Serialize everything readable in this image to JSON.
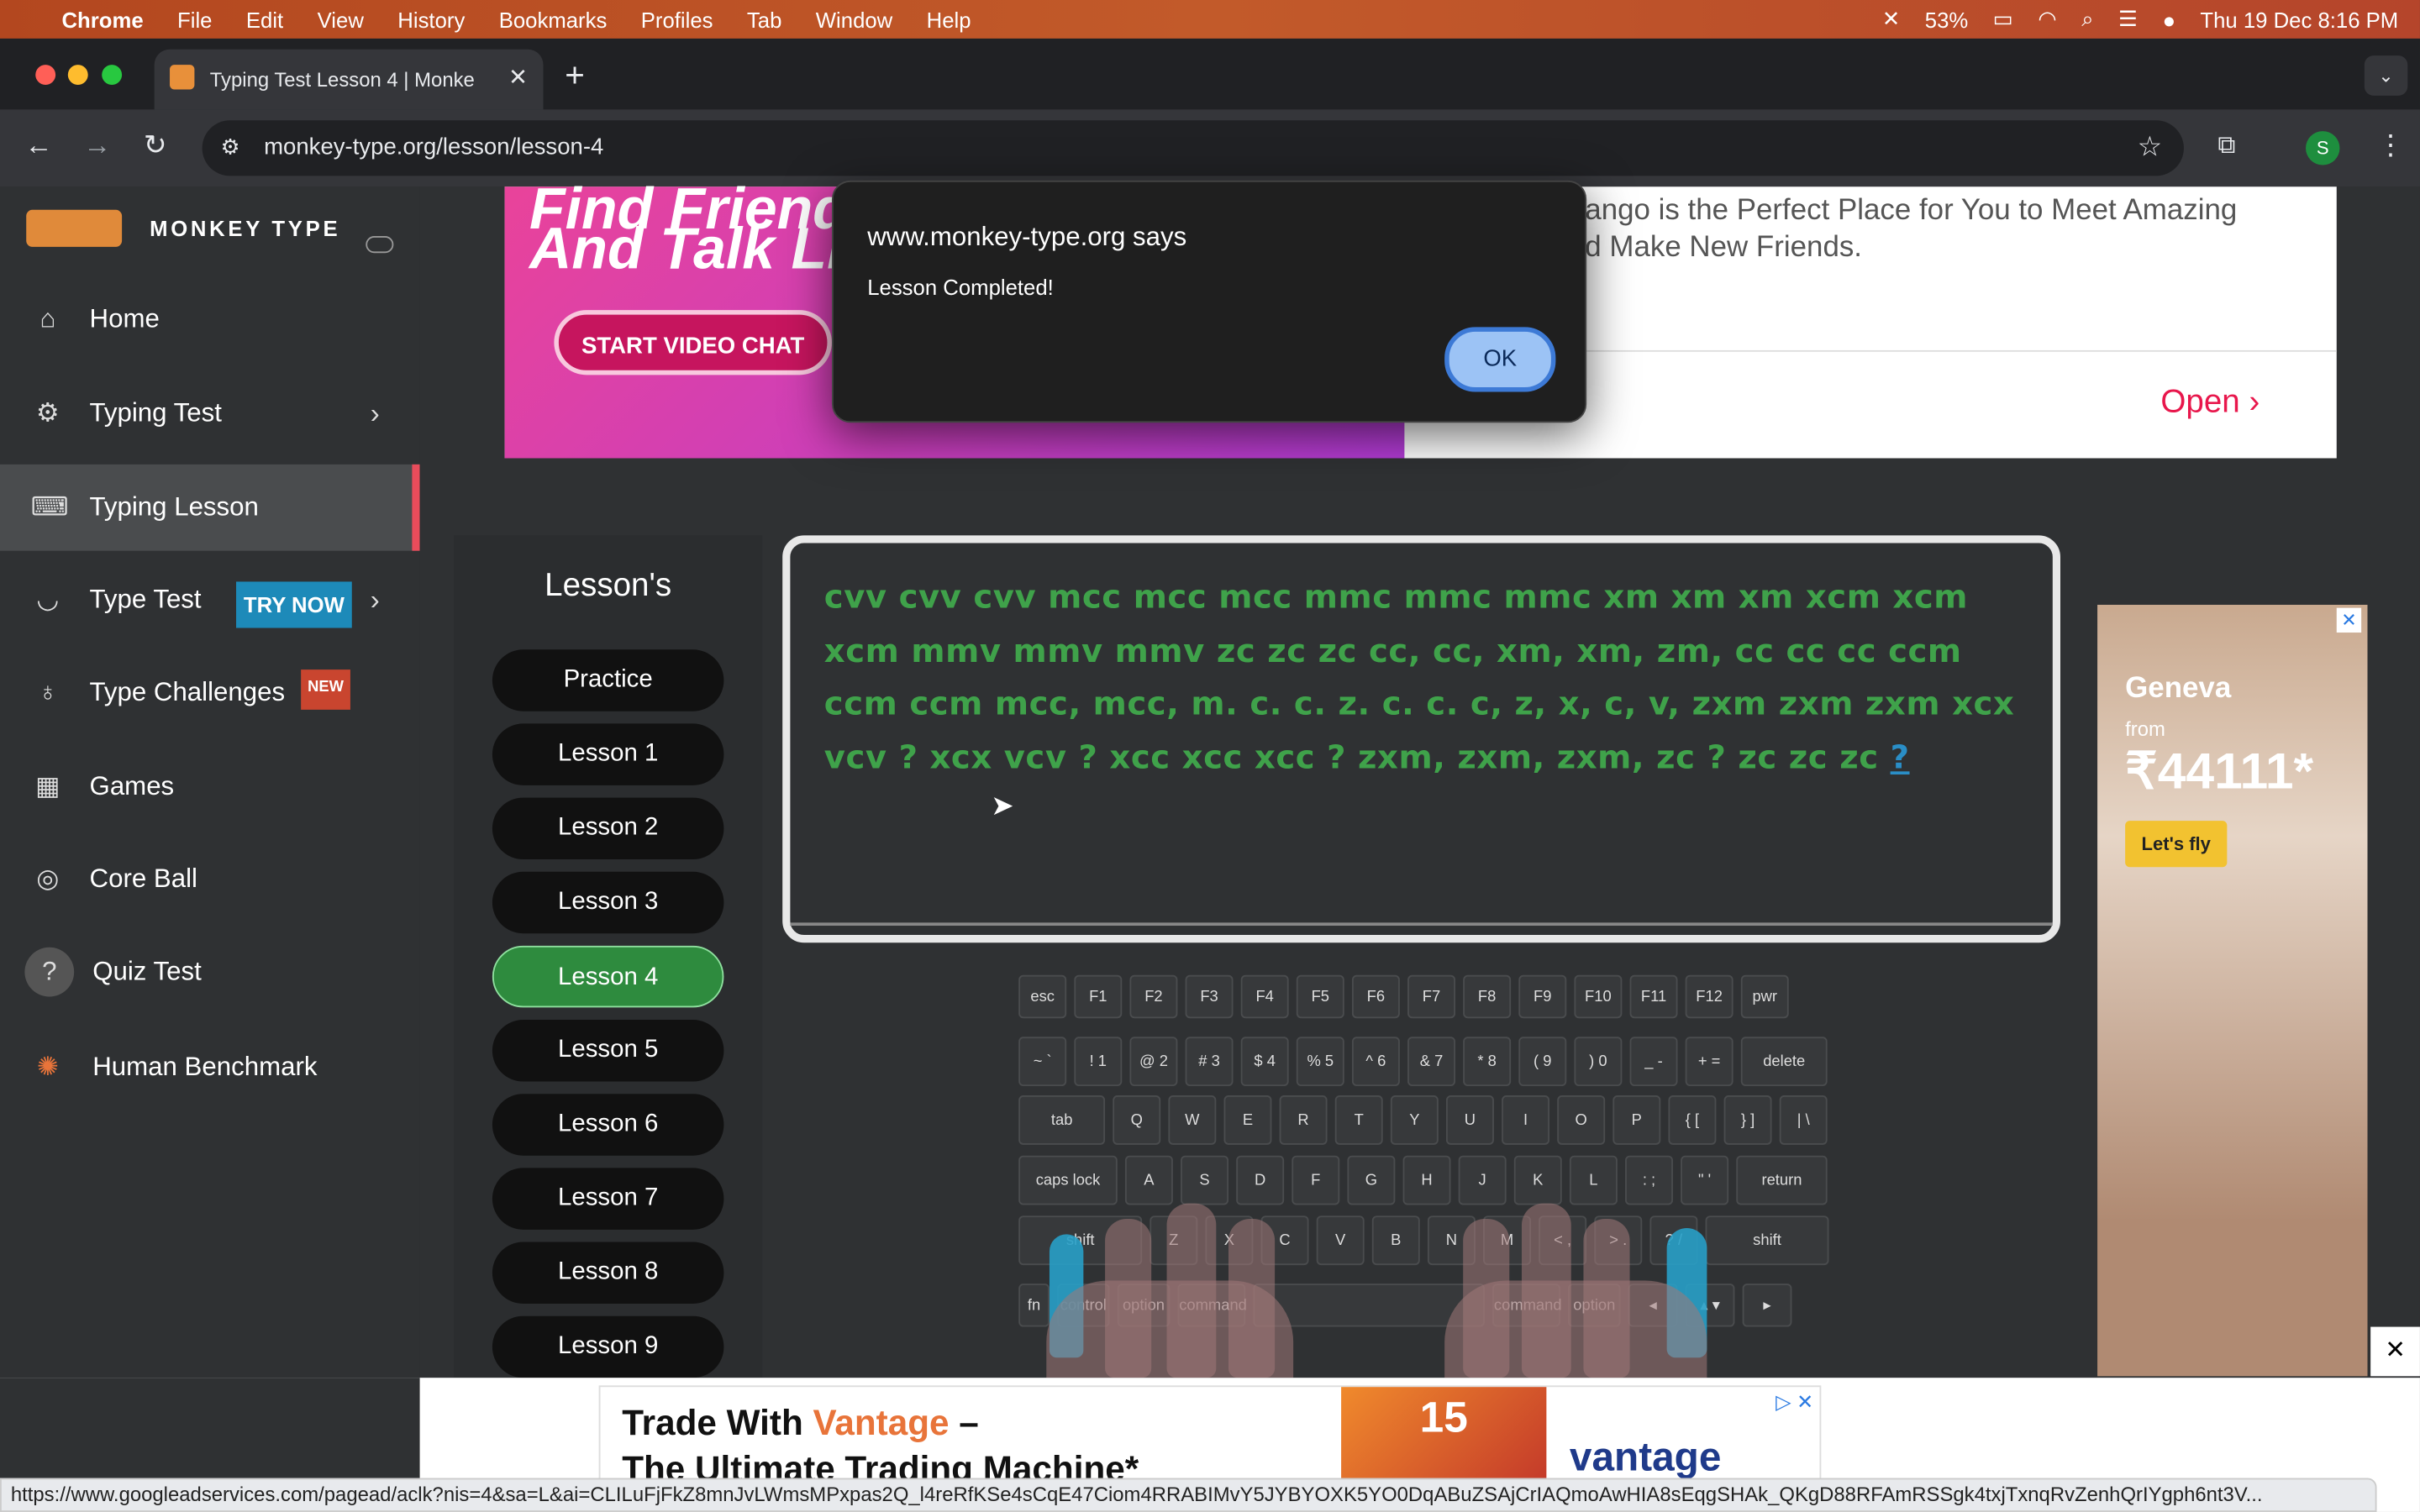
{
  "menubar": {
    "app": "Chrome",
    "items": [
      "File",
      "Edit",
      "View",
      "History",
      "Bookmarks",
      "Profiles",
      "Tab",
      "Window",
      "Help"
    ],
    "battery": "53%",
    "datetime": "Thu 19 Dec  8:16 PM"
  },
  "browser": {
    "tab_title": "Typing Test Lesson 4 | Monke",
    "url": "monkey-type.org/lesson/lesson-4",
    "profile_initial": "S"
  },
  "sidebar": {
    "brand": "MONKEY TYPE",
    "items": [
      {
        "label": "Home",
        "icon": "home-icon"
      },
      {
        "label": "Typing Test",
        "icon": "gear-icon"
      },
      {
        "label": "Typing Lesson",
        "icon": "keyboard-icon"
      },
      {
        "label": "Type Test",
        "icon": "cat-icon"
      },
      {
        "label": "Type Challenges",
        "icon": "award-icon"
      },
      {
        "label": "Games",
        "icon": "grid-icon"
      },
      {
        "label": "Core Ball",
        "icon": "target-icon"
      },
      {
        "label": "Quiz Test",
        "icon": "quiz-icon"
      },
      {
        "label": "Human Benchmark",
        "icon": "brain-icon"
      }
    ],
    "try_now": "TRY NOW",
    "new_badge": "NEW"
  },
  "ad_top": {
    "headline_1": "Find Friends",
    "headline_2": "And Talk Live",
    "cta": "START VIDEO CHAT",
    "text_1": "ango is the Perfect Place for You to Meet Amazing",
    "text_2": "d Make New Friends.",
    "open": "Open"
  },
  "lessons": {
    "title": "Lesson's",
    "items": [
      "Practice",
      "Lesson 1",
      "Lesson 2",
      "Lesson 3",
      "Lesson 4",
      "Lesson 5",
      "Lesson 6",
      "Lesson 7",
      "Lesson 8",
      "Lesson 9"
    ],
    "active": "Lesson 4"
  },
  "typing": {
    "text": "cvv cvv cvv mcc mcc mcc mmc mmc mmc xm xm xm xcm xcm xcm mmv mmv mmv zc zc zc cc, cc, xm, xm, zm, cc cc cc ccm ccm ccm mcc, mcc, m. c. c. z. c. c. c, z, x, c, v, zxm zxm zxm xcx vcv ? xcx vcv ? xcc xcc xcc ? zxm, zxm, zxm, zc ? zc zc zc",
    "cursor_char": "?"
  },
  "keyboard": {
    "rows": [
      [
        "esc",
        "F1",
        "F2",
        "F3",
        "F4",
        "F5",
        "F6",
        "F7",
        "F8",
        "F9",
        "F10",
        "F11",
        "F12",
        "pwr"
      ],
      [
        "~ `",
        "! 1",
        "@ 2",
        "# 3",
        "$ 4",
        "% 5",
        "^ 6",
        "& 7",
        "* 8",
        "( 9",
        ") 0",
        "_ -",
        "+ =",
        "delete"
      ],
      [
        "tab",
        "Q",
        "W",
        "E",
        "R",
        "T",
        "Y",
        "U",
        "I",
        "O",
        "P",
        "{ [",
        "} ]",
        "| \\"
      ],
      [
        "caps lock",
        "A",
        "S",
        "D",
        "F",
        "G",
        "H",
        "J",
        "K",
        "L",
        ": ;",
        "\" '",
        "return"
      ],
      [
        "shift",
        "Z",
        "X",
        "C",
        "V",
        "B",
        "N",
        "M",
        "< ,",
        "> .",
        "? /",
        "shift"
      ],
      [
        "fn",
        "control",
        "option",
        "command",
        "",
        "command",
        "option",
        "◂",
        "▴ ▾",
        "▸"
      ]
    ]
  },
  "ad_right": {
    "city": "Geneva",
    "from": "from",
    "price": "₹44111*",
    "cta": "Let's fly"
  },
  "dialog": {
    "title": "www.monkey-type.org says",
    "message": "Lesson Completed!",
    "ok": "OK"
  },
  "bottom_ad": {
    "line1_a": "Trade With ",
    "line1_b": "Vantage",
    "line1_c": " –",
    "line2": "The Ultimate Trading Machine*",
    "badge": "15",
    "brand": "vantage"
  },
  "status_url": "https://www.googleadservices.com/pagead/aclk?nis=4&sa=L&ai=CLILuFjFkZ8mnJvLWmsMPxpas2Q_l4reRfKSe4sCqE47Ciom4RRABIMvY5JYBYOXK5YO0DqABuZSAjCrIAQmoAwHIA8sEqgSHAk_QKgD88RFAmRSSgk4txjTxnqRvZenhQrIYgph6nt3V..."
}
